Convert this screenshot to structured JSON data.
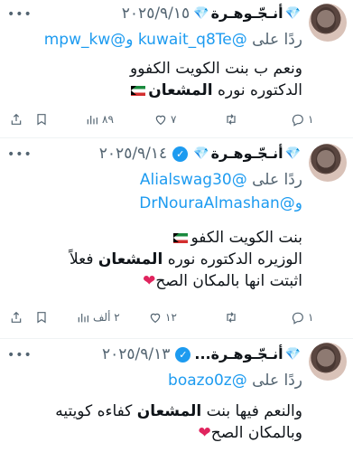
{
  "tweets": [
    {
      "display_name": "أنـجّـوهـرة",
      "date": "٢٠٢٥/٩/١٥",
      "reply_prefix": "ردًا على",
      "reply_line1_handles": "@kuwait_q8Te",
      "reply_and": "و",
      "reply_line1_handle2": "@mpw_kw",
      "body_line1": "ونعم ب بنت الكويت الكفوو",
      "body_line2_a": "الدكتوره نوره",
      "body_line2_b": "المشعان",
      "stats": {
        "reply": "١",
        "retweet": "",
        "like": "٧",
        "views": "٨٩"
      }
    },
    {
      "display_name": "أنـجّـوهـرة",
      "date": "٢٠٢٥/٩/١٤",
      "reply_prefix": "ردًا على",
      "reply_handle1": "@Alialswag30",
      "reply_and": "و",
      "reply_handle2": "@DrNouraAlmashan",
      "body_line1": "بنت الكويت الكفو",
      "body_line2_a": "الوزيره الدكتوره نوره",
      "body_line2_b": "المشعان",
      "body_line2_c": "فعلاً",
      "body_line3": "اثبتت انها بالمكان الصح",
      "stats": {
        "reply": "١",
        "retweet": "",
        "like": "١٢",
        "views": "٢ ألف"
      }
    },
    {
      "display_name": "أنـجّـوهـرة...",
      "date": "٢٠٢٥/٩/١٣",
      "reply_prefix": "ردًا على",
      "reply_handle1": "@boazo0z",
      "body_line1_a": "والنعم فيها بنت",
      "body_line1_b": "المشعان",
      "body_line1_c": "كفاءه كويتيه",
      "body_line2": "وبالمكان الصح"
    }
  ],
  "colors": {
    "accent": "#1d9bf0",
    "muted": "#536471",
    "heart": "#e0245e"
  },
  "icons": [
    "gem-icon",
    "verified-badge-icon",
    "more-icon",
    "reply-icon",
    "retweet-icon",
    "like-icon",
    "views-icon",
    "bookmark-icon",
    "share-icon",
    "kuwait-flag-icon",
    "heart-emoji-icon"
  ]
}
